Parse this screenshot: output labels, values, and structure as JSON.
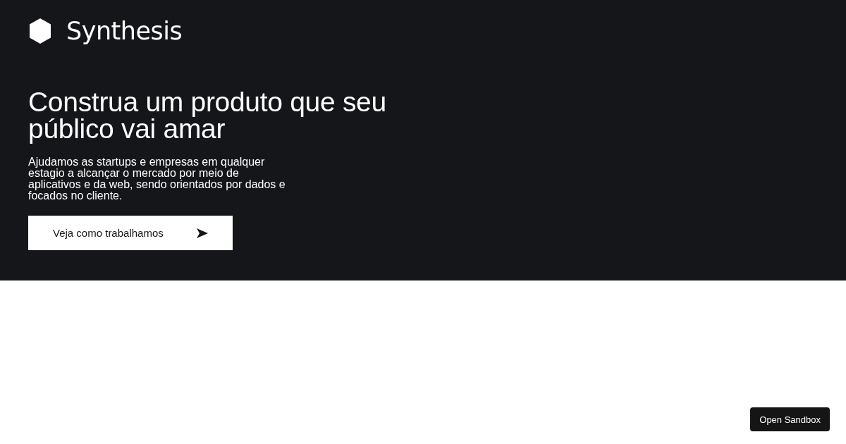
{
  "brand": {
    "name": "Synthesis"
  },
  "hero": {
    "title": "Construa um produto que seu público vai amar",
    "subtitle": "Ajudamos as startups e empresas em qualquer estagio a alcançar o mercado por meio de aplicativos e da web, sendo orientados por dados e focados no cliente.",
    "cta": "Veja como trabalhamos"
  },
  "sandbox_button": "Open Sandbox"
}
